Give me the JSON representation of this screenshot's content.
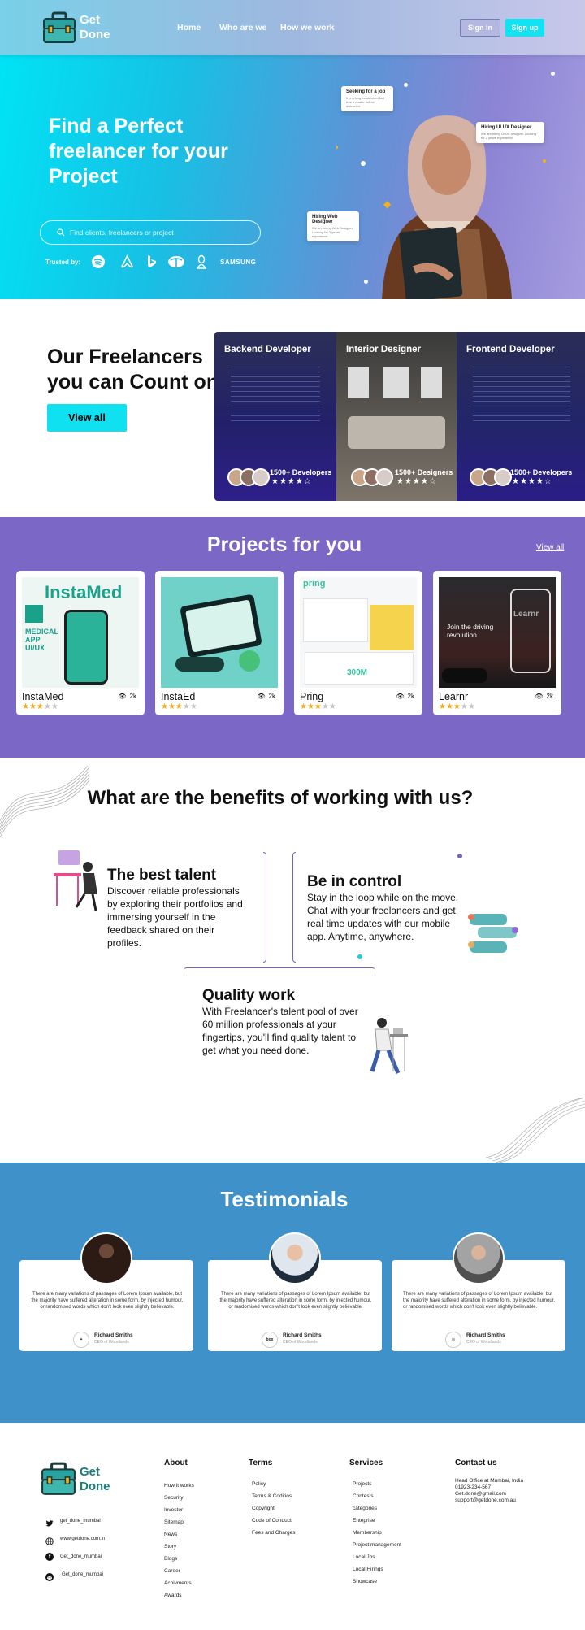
{
  "header": {
    "logo_line1": "Get",
    "logo_line2": "Done",
    "nav": [
      "Home",
      "Who are we",
      "How we work"
    ],
    "signin": "Sign in",
    "signup": "Sign up"
  },
  "hero": {
    "title": "Find a Perfect freelancer for your Project",
    "search_placeholder": "Find clients, freelancers or project",
    "trusted_by": "Trusted by:",
    "brands": [
      "spotify",
      "airbnb",
      "bing",
      "tata",
      "linux",
      "SAMSUNG"
    ],
    "chips": [
      {
        "title": "Seeking for a job",
        "sub": "It is a long established fact that a reader will be distracted"
      },
      {
        "title": "Hiring UI UX Designer",
        "sub": "We are hiring UI UX designer. Looking for 2 years experience"
      },
      {
        "title": "Hiring Web Designer",
        "sub": "We are hiring Web Designer. Looking for 2 years experience"
      }
    ]
  },
  "freelancers": {
    "title": "Our Freelancers you can Count on",
    "view_all": "View all",
    "cards": [
      {
        "name": "Backend Developer",
        "count": "1500+ Developers",
        "stars": "★★★★☆"
      },
      {
        "name": "Interior Designer",
        "count": "1500+ Designers",
        "stars": "★★★★☆"
      },
      {
        "name": "Frontend Developer",
        "count": "1500+ Developers",
        "stars": "★★★★☆"
      }
    ]
  },
  "projects": {
    "title": "Projects for you",
    "view_all": "View all",
    "items": [
      {
        "name": "InstaMed",
        "views": "2k",
        "rating": 3,
        "thumb_text": "InstaMed",
        "thumb_sub": "MEDICAL APP UI/UX"
      },
      {
        "name": "InstaEd",
        "views": "2k",
        "rating": 3,
        "thumb_text": "",
        "thumb_sub": ""
      },
      {
        "name": "Pring",
        "views": "2k",
        "rating": 3,
        "thumb_text": "pring",
        "thumb_sub": "300M"
      },
      {
        "name": "Learnr",
        "views": "2k",
        "rating": 3,
        "thumb_text": "Join the driving revolution.",
        "thumb_sub": "Learnr"
      }
    ]
  },
  "benefits": {
    "title": "What are the benefits of working with us?",
    "items": [
      {
        "heading": "The best talent",
        "body": "Discover reliable professionals by exploring their portfolios and immersing yourself in the feedback shared on their profiles."
      },
      {
        "heading": "Be in control",
        "body": "Stay in the loop while on the move. Chat with your freelancers and get real time updates with our mobile app. Anytime, anywhere."
      },
      {
        "heading": "Quality work",
        "body": "With Freelancer's talent pool of over 60 million professionals at your fingertips, you'll find quality talent to get what you need done."
      }
    ]
  },
  "testimonials": {
    "title": "Testimonials",
    "items": [
      {
        "text": "There are many variations of passages of Lorem Ipsum available, but the majority have suffered alteration in some form, by injected humour, or randomised words which don't look even slightly believable.",
        "name": "Richard Smiths",
        "role": "CEO of Woodlands",
        "logo": "✦"
      },
      {
        "text": "There are many variations of passages of Lorem Ipsum available, but the majority have suffered alteration in some form, by injected humour, or randomised words which don't look even slightly believable.",
        "name": "Richard Smiths",
        "role": "CEO of Woodlands",
        "logo": "box"
      },
      {
        "text": "There are many variations of passages of Lorem Ipsum available, but the majority have suffered alteration in some form, by injected humour, or randomised words which don't look even slightly believable.",
        "name": "Richard Smiths",
        "role": "CEO of Woodlands",
        "logo": "◎"
      }
    ]
  },
  "footer": {
    "logo_line1": "Get",
    "logo_line2": "Done",
    "social": [
      "get_done_mumbai",
      "www.getdone.com.in",
      "Get_done_mumbai",
      "Get_done_mumbai"
    ],
    "about": {
      "heading": "About",
      "items": [
        "How it works",
        "Security",
        "Investor",
        "Sitemap",
        "News",
        "Story",
        "Blogs",
        "Career",
        "Achivments",
        "Awards"
      ]
    },
    "terms": {
      "heading": "Terms",
      "items": [
        "Policy",
        "Terms & Coditios",
        "Copyright",
        "Code of Conduct",
        "Fees and Charges"
      ]
    },
    "services": {
      "heading": "Services",
      "items": [
        "Projects",
        "Contests",
        "categories",
        "Enteprise",
        "Membership",
        "Project management",
        "Local Jbs",
        "Local Hirings",
        "Showcase"
      ]
    },
    "contact": {
      "heading": "Contact us",
      "items": [
        "Head Office at Mumbai, India",
        "01923-234-567",
        "Get.done@gmail.com",
        "support@getdone.com.au"
      ]
    }
  },
  "colors": {
    "accent": "#10e1f0",
    "purple": "#7b67c6",
    "testimonials_bg": "#3f92c9"
  }
}
